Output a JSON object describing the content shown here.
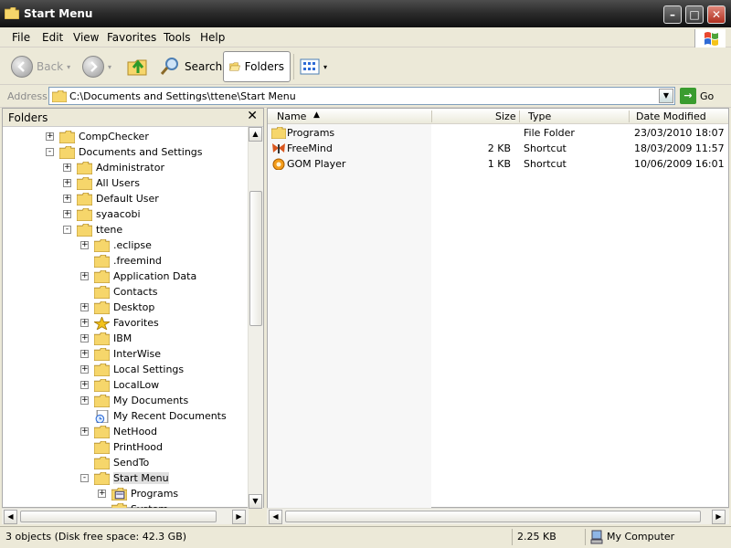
{
  "window": {
    "title": "Start Menu"
  },
  "menu": [
    "File",
    "Edit",
    "View",
    "Favorites",
    "Tools",
    "Help"
  ],
  "toolbar": {
    "back_label": "Back",
    "search_label": "Search",
    "folders_label": "Folders"
  },
  "address": {
    "label": "Address",
    "path": "C:\\Documents and Settings\\ttene\\Start Menu",
    "go_label": "Go"
  },
  "folders_pane": {
    "title": "Folders",
    "tree": [
      {
        "label": "CompChecker",
        "expander": "+",
        "icon": "folder"
      },
      {
        "label": "Documents and Settings",
        "expander": "-",
        "icon": "folder"
      },
      {
        "label": "Administrator",
        "expander": "+",
        "icon": "folder"
      },
      {
        "label": "All Users",
        "expander": "+",
        "icon": "folder"
      },
      {
        "label": "Default User",
        "expander": "+",
        "icon": "folder"
      },
      {
        "label": "syaacobi",
        "expander": "+",
        "icon": "folder"
      },
      {
        "label": "ttene",
        "expander": "-",
        "icon": "folder"
      },
      {
        "label": ".eclipse",
        "expander": "+",
        "icon": "folder"
      },
      {
        "label": ".freemind",
        "expander": "",
        "icon": "folder"
      },
      {
        "label": "Application Data",
        "expander": "+",
        "icon": "folder"
      },
      {
        "label": "Contacts",
        "expander": "",
        "icon": "folder"
      },
      {
        "label": "Desktop",
        "expander": "+",
        "icon": "folder"
      },
      {
        "label": "Favorites",
        "expander": "+",
        "icon": "star"
      },
      {
        "label": "IBM",
        "expander": "+",
        "icon": "folder"
      },
      {
        "label": "InterWise",
        "expander": "+",
        "icon": "folder"
      },
      {
        "label": "Local Settings",
        "expander": "+",
        "icon": "folder"
      },
      {
        "label": "LocalLow",
        "expander": "+",
        "icon": "folder"
      },
      {
        "label": "My Documents",
        "expander": "+",
        "icon": "folder"
      },
      {
        "label": "My Recent Documents",
        "expander": "",
        "icon": "recent"
      },
      {
        "label": "NetHood",
        "expander": "+",
        "icon": "folder"
      },
      {
        "label": "PrintHood",
        "expander": "",
        "icon": "folder"
      },
      {
        "label": "SendTo",
        "expander": "",
        "icon": "folder"
      },
      {
        "label": "Start Menu",
        "expander": "-",
        "icon": "folder"
      },
      {
        "label": "Programs",
        "expander": "+",
        "icon": "programs"
      },
      {
        "label": "System",
        "expander": "",
        "icon": "folder"
      }
    ]
  },
  "list": {
    "columns": [
      "Name",
      "Size",
      "Type",
      "Date Modified"
    ],
    "rows": [
      {
        "name": "Programs",
        "size": "",
        "type": "File Folder",
        "date": "23/03/2010 18:07",
        "icon": "folder"
      },
      {
        "name": "FreeMind",
        "size": "2 KB",
        "type": "Shortcut",
        "date": "18/03/2009 11:57",
        "icon": "butterfly"
      },
      {
        "name": "GOM Player",
        "size": "1 KB",
        "type": "Shortcut",
        "date": "10/06/2009 16:01",
        "icon": "gom"
      }
    ]
  },
  "status": {
    "objects": "3 objects (Disk free space: 42.3 GB)",
    "size": "2.25 KB",
    "location": "My Computer"
  }
}
